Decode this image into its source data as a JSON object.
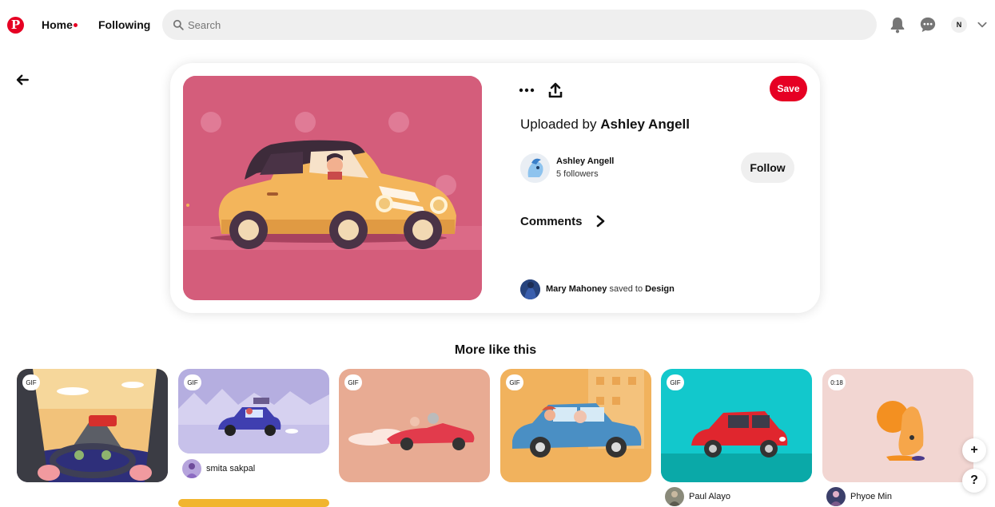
{
  "header": {
    "logo_letter": "P",
    "home_label": "Home",
    "following_label": "Following",
    "search_placeholder": "Search",
    "user_initial": "N"
  },
  "pin": {
    "save_label": "Save",
    "uploaded_prefix": "Uploaded by",
    "uploader": "Ashley Angell",
    "creator_name": "Ashley Angell",
    "creator_followers": "5 followers",
    "follow_label": "Follow",
    "comments_label": "Comments",
    "saver_name": "Mary Mahoney",
    "saved_to_text": "saved to",
    "board_name": "Design"
  },
  "more_like_this": {
    "title": "More like this",
    "tiles": [
      {
        "badge": "GIF",
        "bg": "#f2c27a",
        "pinner": ""
      },
      {
        "badge": "GIF",
        "bg": "#b5aee0",
        "pinner": "smita sakpal"
      },
      {
        "badge": "GIF",
        "bg": "#e8ab93",
        "pinner": ""
      },
      {
        "badge": "GIF",
        "bg": "#f1b25d",
        "pinner": ""
      },
      {
        "badge": "GIF",
        "bg": "#12c8cc",
        "pinner": "Paul Alayo"
      },
      {
        "badge": "0:18",
        "bg": "#f2d6d2",
        "pinner": "Phyoe Min"
      }
    ]
  },
  "float": {
    "plus_label": "+",
    "help_label": "?"
  },
  "colors": {
    "brand": "#e60023",
    "pin_bg": "#d45d7b"
  }
}
